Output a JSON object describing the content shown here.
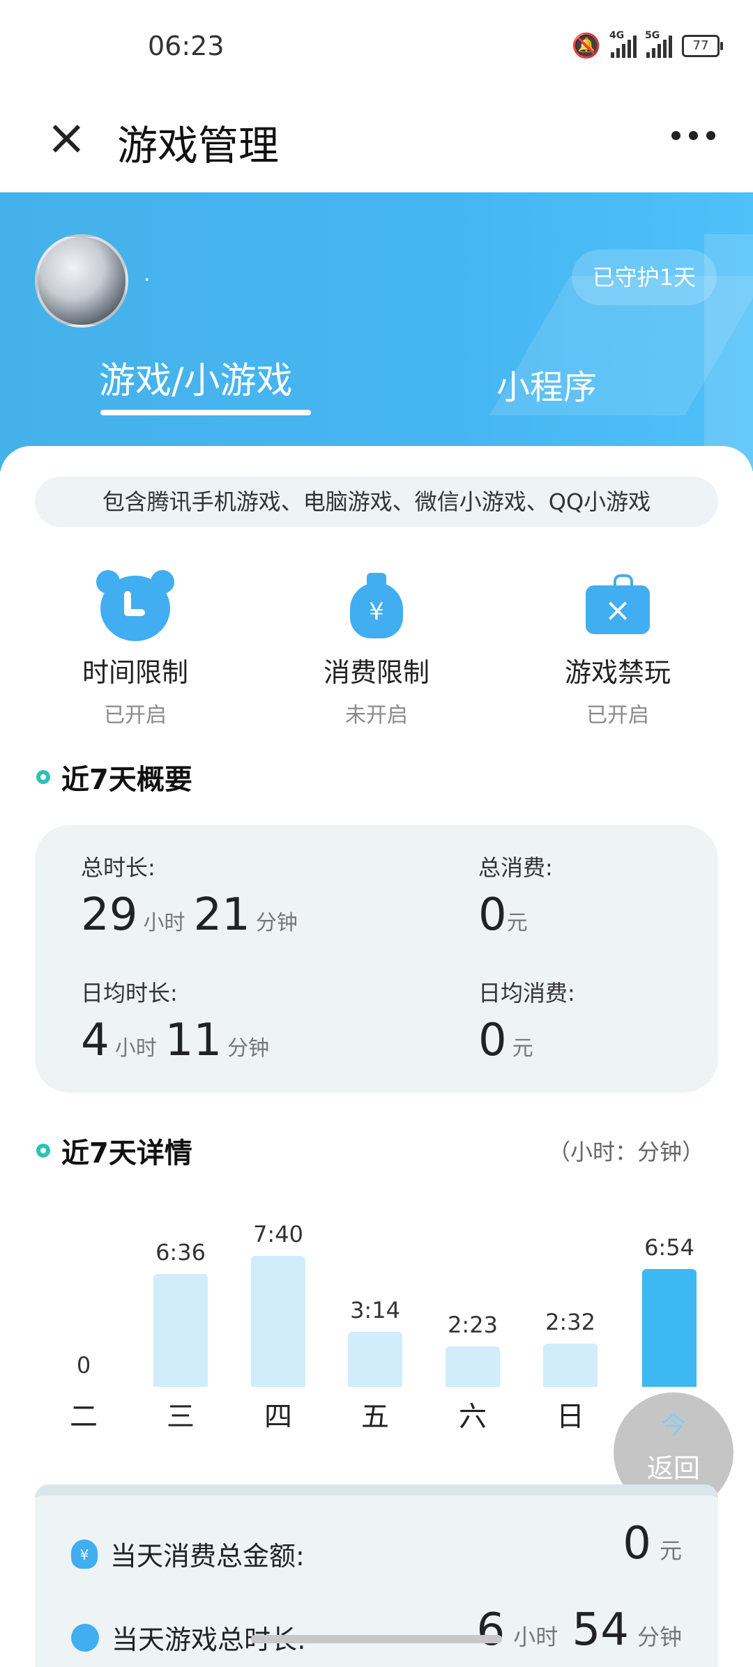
{
  "status_bar": {
    "time": "06:23",
    "battery": "77",
    "net1": "4G",
    "net2": "5G"
  },
  "header": {
    "title": "游戏管理"
  },
  "profile": {
    "nickname": ".",
    "guard_badge": "已守护1天"
  },
  "tabs": [
    {
      "label": "游戏/小游戏"
    },
    {
      "label": "小程序"
    }
  ],
  "notice": "包含腾讯手机游戏、电脑游戏、微信小游戏、QQ小游戏",
  "features": [
    {
      "name": "时间限制",
      "state": "已开启",
      "icon": "clock-icon"
    },
    {
      "name": "消费限制",
      "state": "未开启",
      "icon": "money-bag-icon"
    },
    {
      "name": "游戏禁玩",
      "state": "已开启",
      "icon": "game-ban-icon"
    }
  ],
  "summary": {
    "title": "近7天概要",
    "total_time_label": "总时长:",
    "total_hours": "29",
    "total_minutes": "21",
    "total_spend_label": "总消费:",
    "total_spend": "0",
    "avg_time_label": "日均时长:",
    "avg_hours": "4",
    "avg_minutes": "11",
    "avg_spend_label": "日均消费:",
    "avg_spend": "0",
    "unit_hour": "小时",
    "unit_minute": "分钟",
    "unit_yuan": "元"
  },
  "details": {
    "title": "近7天详情",
    "unit_hint": "（小时：分钟）"
  },
  "chart_data": {
    "type": "bar",
    "categories": [
      "二",
      "三",
      "四",
      "五",
      "六",
      "日",
      "今"
    ],
    "values": [
      0,
      6.6,
      7.667,
      3.233,
      2.383,
      2.533,
      6.9
    ],
    "labels": [
      "0",
      "6:36",
      "7:40",
      "3:14",
      "2:23",
      "2:32",
      "6:54"
    ],
    "highlight_index": 6,
    "colors": {
      "normal": "#d1edfc",
      "highlight": "#3db8f2"
    }
  },
  "float_button": {
    "label": "返回",
    "top_char": "今"
  },
  "today": {
    "spend_label": "当天消费总金额:",
    "spend_value": "0",
    "time_label": "当天游戏总时长:",
    "hours": "6",
    "minutes": "54"
  }
}
